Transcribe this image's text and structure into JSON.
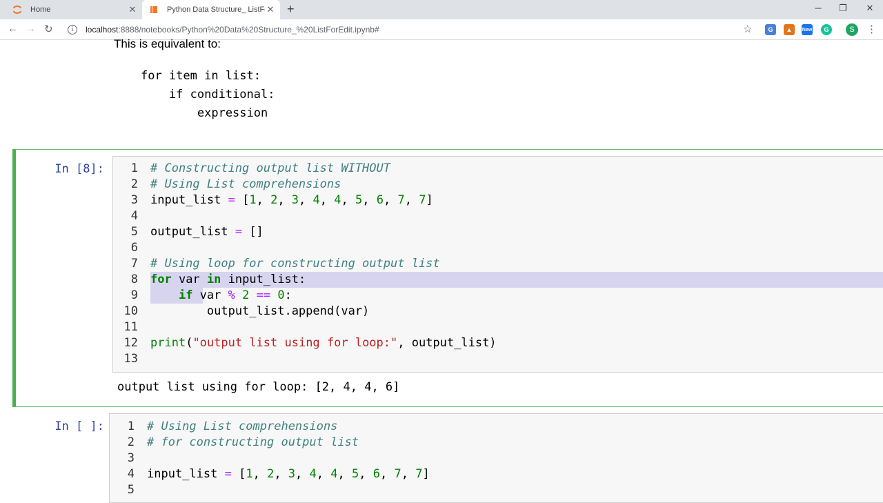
{
  "browser": {
    "tabs": [
      {
        "label": "Home",
        "active": false
      },
      {
        "label": "Python Data Structure_ ListForEdit",
        "active": true
      }
    ],
    "url_host": "localhost",
    "url_path": ":8888/notebooks/Python%20Data%20Structure_%20ListForEdit.ipynb#",
    "profile_initial": "S",
    "extensions": [
      "translate-icon",
      "metamask-icon",
      "new-badge-icon",
      "grammarly-icon"
    ],
    "ext_new_label": "New"
  },
  "markdown": {
    "text": "This is equivalent to:",
    "code_lines": [
      "for item in list:",
      "    if conditional:",
      "        expression"
    ]
  },
  "cell1": {
    "prompt": "In [8]:",
    "output": "output list using for loop: [2, 4, 4, 6]",
    "line_numbers": [
      "1",
      "2",
      "3",
      "4",
      "5",
      "6",
      "7",
      "8",
      "9",
      "10",
      "11",
      "12",
      "13"
    ]
  },
  "cell2": {
    "prompt": "In [ ]:",
    "line_numbers": [
      "1",
      "2",
      "3",
      "4",
      "5"
    ]
  },
  "colors": {
    "selected_cell_border": "#4caf50",
    "prompt": "#303f9f",
    "comment": "#408080",
    "keyword": "#008000",
    "string": "#ba2121",
    "operator": "#aa22ff",
    "selection": "#d7d4f0"
  }
}
